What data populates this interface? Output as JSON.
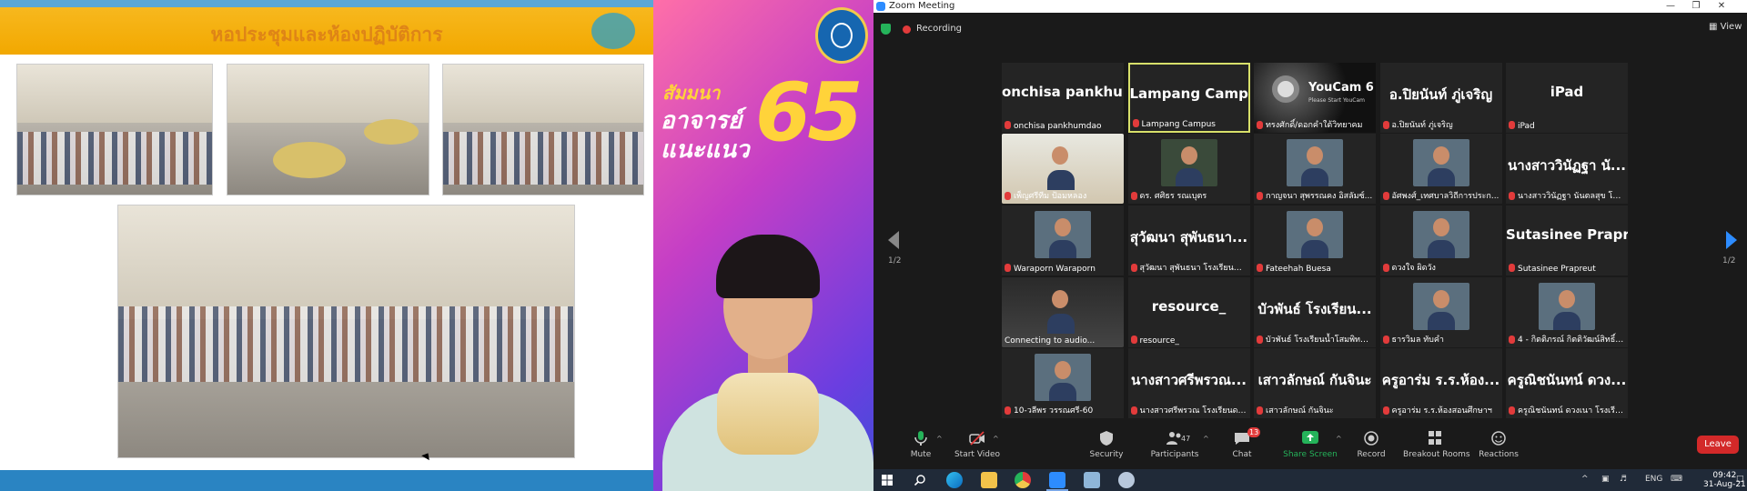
{
  "slide": {
    "title": "หอประชุมและห้องปฏิบัติการ"
  },
  "speaker": {
    "promo_line1": "สัมมนา",
    "promo_line2": "อาจารย์",
    "promo_line3": "แนะแนว",
    "promo_number": "65"
  },
  "zoom": {
    "window_title": "Zoom Meeting",
    "recording_label": "Recording",
    "view_label": "View",
    "page_indicator_left": "1/2",
    "page_indicator_right": "1/2",
    "tiles": [
      {
        "big": "onchisa pankhu...",
        "label": "onchisa pankhumdao"
      },
      {
        "big": "Lampang Campus",
        "label": "Lampang Campus",
        "active": true
      },
      {
        "big": "",
        "label": "ทรงศักดิ์/ดอกคำใต้วิทยาคม",
        "camera_brand": "YouCam 6",
        "camera_sub": "Please Start YouCam"
      },
      {
        "big": "อ.ปิยนันท์ ภู่เจริญ",
        "label": "อ.ปิยนันท์ ภู่เจริญ"
      },
      {
        "big": "iPad",
        "label": "iPad"
      },
      {
        "big": "",
        "label": "เพ็ญศรีทีม ป้อมหลอง"
      },
      {
        "big": "",
        "label": "ดร. ศศิธร รณเบุตร"
      },
      {
        "big": "",
        "label": "กาญจนา สุพรรณคง อิสลัมซ์..."
      },
      {
        "big": "",
        "label": "อัศพงศ์_เทศบาลวิถีการประก..."
      },
      {
        "big": "นางสาววินัฏฐา นั...",
        "label": "นางสาววินัฏฐา นันตลสุข โรงเรี..."
      },
      {
        "big": "",
        "label": "Waraporn Waraporn"
      },
      {
        "big": "สุวัฒนา สุพันธนา...",
        "label": "สุวัฒนา สุพันธนา โรงเรียนพิบู..."
      },
      {
        "big": "",
        "label": "Fateehah Buesa"
      },
      {
        "big": "",
        "label": "ดวงใจ ผิดวัง"
      },
      {
        "big": "Sutasinee Prapr...",
        "label": "Sutasinee Prapreut"
      },
      {
        "big": "",
        "label": "Connecting to audio...",
        "connecting": true
      },
      {
        "big": "resource_",
        "label": "resource_"
      },
      {
        "big": "บัวพันธ์ โรงเรียน...",
        "label": "บัวพันธ์ โรงเรียนน้ำโสมพิทยา..."
      },
      {
        "big": "",
        "label": "ธารวิมล ทับคำ"
      },
      {
        "big": "",
        "label": "4 - กิตติภรณ์ กิตติวัฒน์สิทธิ์ -..."
      },
      {
        "big": "",
        "label": "10-วลีพร วรรณศรี-60"
      },
      {
        "big": "นางสาวศรีพรวณ...",
        "label": "นางสาวศรีพรวณ โรงเรียนดาร..."
      },
      {
        "big": "เสาวลักษณ์ กันจินะ",
        "label": "เสาวลักษณ์ กันจินะ"
      },
      {
        "big": "ครูอาร่ม ร.ร.ห้อง...",
        "label": "ครูอาร่ม ร.ร.ห้องสอนศึกษาฯ"
      },
      {
        "big": "ครูณิชนันทน์ ดวง...",
        "label": "ครูณิชนันทน์ ดวงเนา โรงเรีย..."
      }
    ],
    "toolbar": {
      "mute": "Mute",
      "start_video": "Start Video",
      "security": "Security",
      "participants": "Participants",
      "participants_count": "47",
      "chat": "Chat",
      "chat_badge": "13",
      "share_screen": "Share Screen",
      "record": "Record",
      "breakout_rooms": "Breakout Rooms",
      "reactions": "Reactions",
      "leave": "Leave"
    }
  },
  "taskbar": {
    "language": "ENG",
    "time": "09:42",
    "date": "31-Aug-21"
  },
  "colors": {
    "zoom_blue": "#2d8cff",
    "share_green": "#25b35a",
    "leave_red": "#d32929",
    "active_speaker": "#d8e06a",
    "slide_header": "#f2a800"
  }
}
